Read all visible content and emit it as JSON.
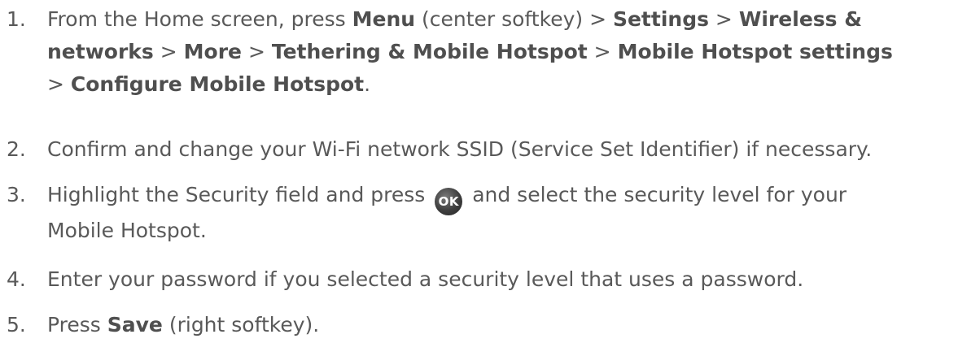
{
  "steps": [
    {
      "number": "1.",
      "lines": [
        [
          {
            "t": "From the Home screen, press ",
            "b": false
          },
          {
            "t": "Menu",
            "b": true
          },
          {
            "t": " (center softkey) > ",
            "b": false
          },
          {
            "t": "Settings",
            "b": true
          },
          {
            "t": " > ",
            "b": false
          },
          {
            "t": "Wireless &",
            "b": true
          }
        ],
        [
          {
            "t": "networks",
            "b": true
          },
          {
            "t": " > ",
            "b": false
          },
          {
            "t": "More",
            "b": true
          },
          {
            "t": " > ",
            "b": false
          },
          {
            "t": "Tethering & Mobile Hotspot",
            "b": true
          },
          {
            "t": " > ",
            "b": false
          },
          {
            "t": "Mobile Hotspot settings",
            "b": true
          }
        ],
        [
          {
            "t": "> ",
            "b": false
          },
          {
            "t": "Configure Mobile Hotspot",
            "b": true
          },
          {
            "t": ".",
            "b": false
          }
        ]
      ]
    },
    {
      "number": "2.",
      "lines": [
        [
          {
            "t": "Confirm and change your Wi-Fi network SSID (Service Set Identifier) if necessary.",
            "b": false
          }
        ]
      ]
    },
    {
      "number": "3.",
      "lines": [
        [
          {
            "t": "Highlight the Security field and press ",
            "b": false
          },
          {
            "icon": "ok-button-icon",
            "label": "OK"
          },
          {
            "t": " and select the security level for your",
            "b": false
          }
        ],
        [
          {
            "t": "Mobile Hotspot.",
            "b": false
          }
        ]
      ]
    },
    {
      "number": "4.",
      "lines": [
        [
          {
            "t": "Enter your password if you selected a security level that uses a password.",
            "b": false
          }
        ]
      ]
    },
    {
      "number": "5.",
      "lines": [
        [
          {
            "t": "Press ",
            "b": false
          },
          {
            "t": "Save",
            "b": true
          },
          {
            "t": " (right softkey).",
            "b": false
          }
        ]
      ]
    }
  ]
}
